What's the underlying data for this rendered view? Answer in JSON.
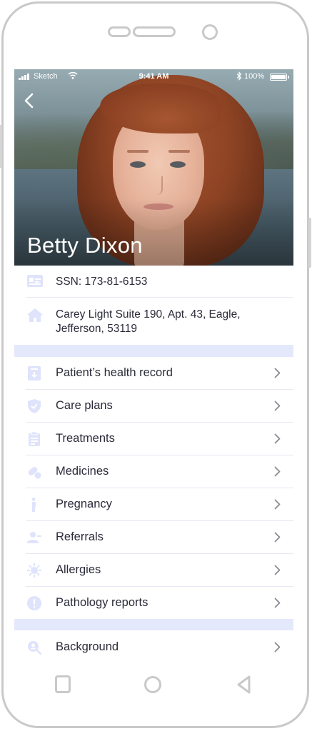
{
  "status_bar": {
    "carrier": "Sketch",
    "time": "9:41 AM",
    "battery": "100%"
  },
  "profile": {
    "name": "Betty Dixon",
    "ssn": "SSN: 173-81-6153",
    "address_line1": "Carey Light Suite 190, Apt. 43, Eagle,",
    "address_line2": "Jefferson, 53119"
  },
  "menu": {
    "items": [
      {
        "label": "Patient’s health record",
        "icon": "health-record-icon"
      },
      {
        "label": "Care plans",
        "icon": "shield-check-icon"
      },
      {
        "label": "Treatments",
        "icon": "clipboard-icon"
      },
      {
        "label": "Medicines",
        "icon": "pill-icon"
      },
      {
        "label": "Pregnancy",
        "icon": "pregnancy-icon"
      },
      {
        "label": "Referrals",
        "icon": "person-referral-icon"
      },
      {
        "label": "Allergies",
        "icon": "virus-icon"
      },
      {
        "label": "Pathology reports",
        "icon": "alert-circle-icon"
      }
    ],
    "secondary_items": [
      {
        "label": "Background",
        "icon": "search-person-icon"
      }
    ]
  },
  "colors": {
    "icon": "#dfe3fb",
    "band": "#e4e8fb",
    "text": "#2b2b3a",
    "chevron": "#8a8a95"
  }
}
